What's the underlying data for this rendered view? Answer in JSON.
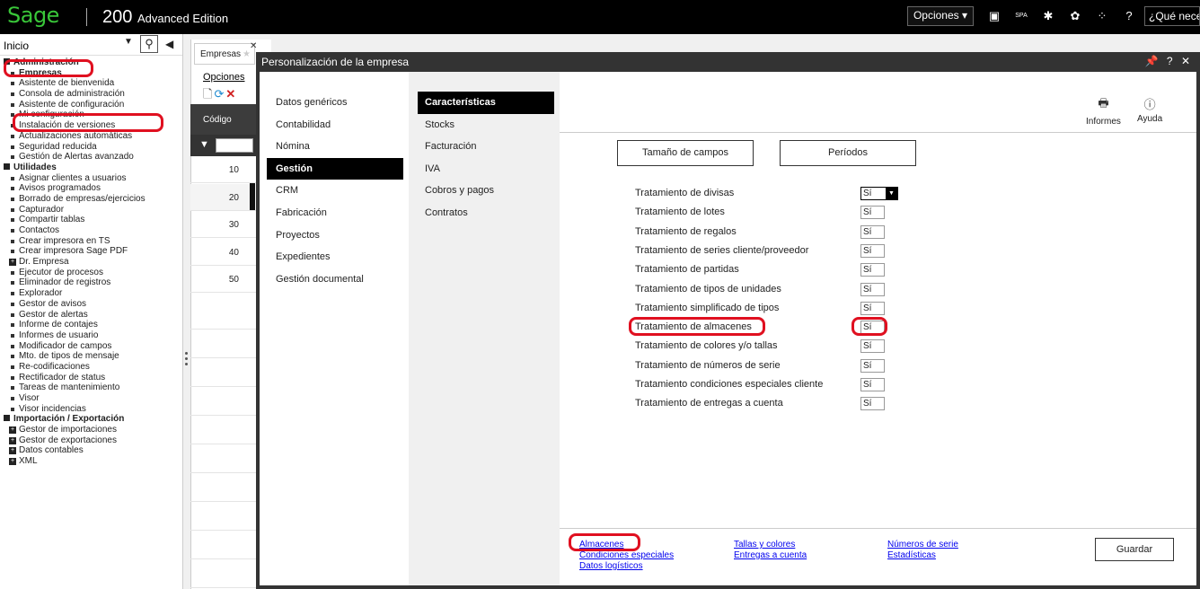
{
  "topbar": {
    "logo": "Sage",
    "product_main": "200",
    "product_edition": "Advanced Edition",
    "opciones_label": "Opciones",
    "language": "SPA",
    "help_search": "¿Qué necesit"
  },
  "sidebar": {
    "dropdown_value": "Inicio",
    "sections": [
      {
        "title": "Administración",
        "items": [
          "Empresas",
          "Asistente de bienvenida",
          "Consola de administración",
          "Asistente de configuración",
          "Mi configuración",
          "Instalación de versiones",
          "Actualizaciones automáticas",
          "Seguridad reducida",
          "Gestión de Alertas avanzado"
        ]
      },
      {
        "title": "Utilidades",
        "items": [
          "Asignar clientes a usuarios",
          "Avisos programados",
          "Borrado de empresas/ejercicios",
          "Capturador",
          "Compartir tablas",
          "Contactos",
          "Crear impresora en TS",
          "Crear impresora Sage PDF",
          "Dr. Empresa",
          "Ejecutor de procesos",
          "Eliminador de registros",
          "Explorador",
          "Gestor de avisos",
          "Gestor de alertas",
          "Informe de contajes",
          "Informes de usuario",
          "Modificador de campos",
          "Mto. de tipos de mensaje",
          "Re-codificaciones",
          "Rectificador de status",
          "Tareas de mantenimiento",
          "Visor",
          "Visor incidencias"
        ]
      },
      {
        "title": "Importación / Exportación",
        "items": [
          "Gestor de importaciones",
          "Gestor de exportaciones",
          "Datos contables",
          "XML"
        ]
      }
    ]
  },
  "background_tab": {
    "tab_label": "Empresas",
    "menu_label": "Opciones",
    "column_header": "Código",
    "rows": [
      "10",
      "20",
      "30",
      "40",
      "50"
    ]
  },
  "modal": {
    "title": "Personalización de la empresa",
    "categories": [
      "Datos genéricos",
      "Contabilidad",
      "Nómina",
      "Gestión",
      "CRM",
      "Fabricación",
      "Proyectos",
      "Expedientes",
      "Gestión documental"
    ],
    "active_category": "Gestión",
    "subcategories": [
      "Características",
      "Stocks",
      "Facturación",
      "IVA",
      "Cobros y pagos",
      "Contratos"
    ],
    "active_subcategory": "Características",
    "toolbar": {
      "informes_label": "Informes",
      "ayuda_label": "Ayuda"
    },
    "buttons": {
      "tamano": "Tamaño de campos",
      "periodos": "Períodos",
      "guardar": "Guardar"
    },
    "settings": [
      {
        "label": "Tratamiento de divisas",
        "value": "Sí"
      },
      {
        "label": "Tratamiento de lotes",
        "value": "Sí"
      },
      {
        "label": "Tratamiento de regalos",
        "value": "Sí"
      },
      {
        "label": "Tratamiento de series cliente/proveedor",
        "value": "Sí"
      },
      {
        "label": "Tratamiento de partidas",
        "value": "Sí"
      },
      {
        "label": "Tratamiento de tipos de unidades",
        "value": "Sí"
      },
      {
        "label": "Tratamiento simplificado de tipos",
        "value": "Sí"
      },
      {
        "label": "Tratamiento de almacenes",
        "value": "Sí"
      },
      {
        "label": "Tratamiento de colores y/o tallas",
        "value": "Sí"
      },
      {
        "label": "Tratamiento de números de serie",
        "value": "Sí"
      },
      {
        "label": "Tratamiento condiciones especiales cliente",
        "value": "Sí"
      },
      {
        "label": "Tratamiento de entregas a cuenta",
        "value": "Sí"
      }
    ],
    "links": {
      "almacenes": "Almacenes",
      "condiciones": "Condiciones especiales",
      "logisticos": "Datos logísticos",
      "tallas": "Tallas y colores",
      "entregas": "Entregas a cuenta",
      "numeros": "Números de serie",
      "estadisticas": "Estadísticas"
    }
  },
  "colors": {
    "highlight": "#e01020",
    "brand_green": "#39c639",
    "link": "#0000ee"
  }
}
